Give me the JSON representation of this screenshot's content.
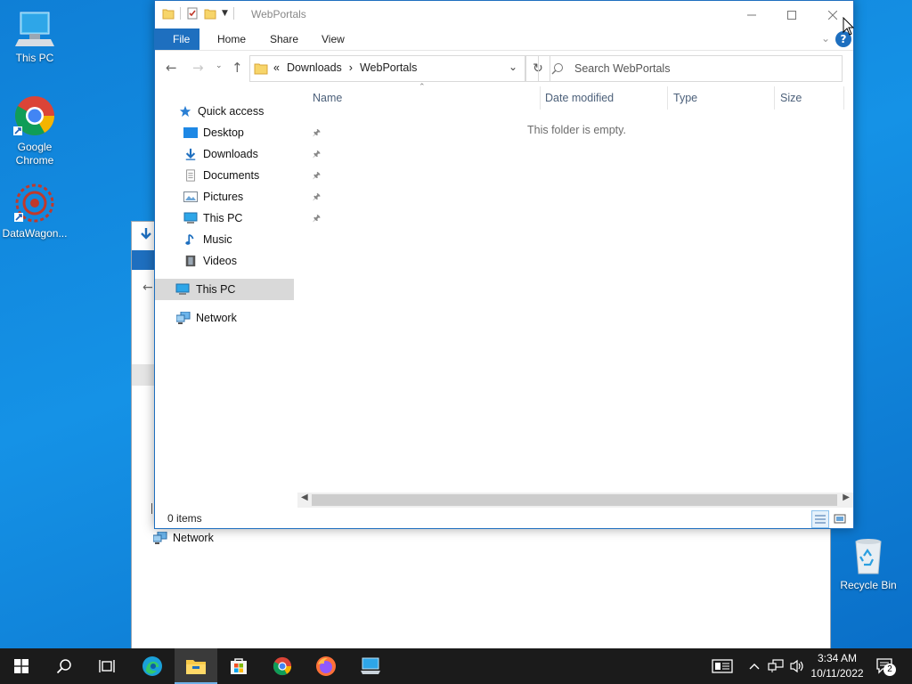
{
  "desktop": {
    "icons": [
      {
        "label": "This PC"
      },
      {
        "label": "Google Chrome"
      },
      {
        "label": "DataWagon..."
      },
      {
        "label": "Recycle Bin"
      }
    ]
  },
  "background_window": {
    "nav_network": "Network"
  },
  "explorer": {
    "title": "WebPortals",
    "ribbon_tabs": {
      "file": "File",
      "home": "Home",
      "share": "Share",
      "view": "View"
    },
    "help": "?",
    "address": {
      "crumb_overflow": "«",
      "crumb1": "Downloads",
      "crumb2": "WebPortals",
      "sep": "›"
    },
    "search_placeholder": "Search WebPortals",
    "nav": {
      "quick_access": "Quick access",
      "desktop": "Desktop",
      "downloads": "Downloads",
      "documents": "Documents",
      "pictures": "Pictures",
      "this_pc_pinned": "This PC",
      "music": "Music",
      "videos": "Videos",
      "this_pc": "This PC",
      "network": "Network"
    },
    "columns": {
      "name": "Name",
      "date_modified": "Date modified",
      "type": "Type",
      "size": "Size"
    },
    "empty_message": "This folder is empty.",
    "status": "0 items"
  },
  "taskbar": {
    "clock_time": "3:34 AM",
    "clock_date": "10/11/2022",
    "notification_count": "2"
  },
  "colors": {
    "accent": "#1e6fbf",
    "taskbar": "#1b1b1b",
    "desktop": "#1584d8"
  }
}
